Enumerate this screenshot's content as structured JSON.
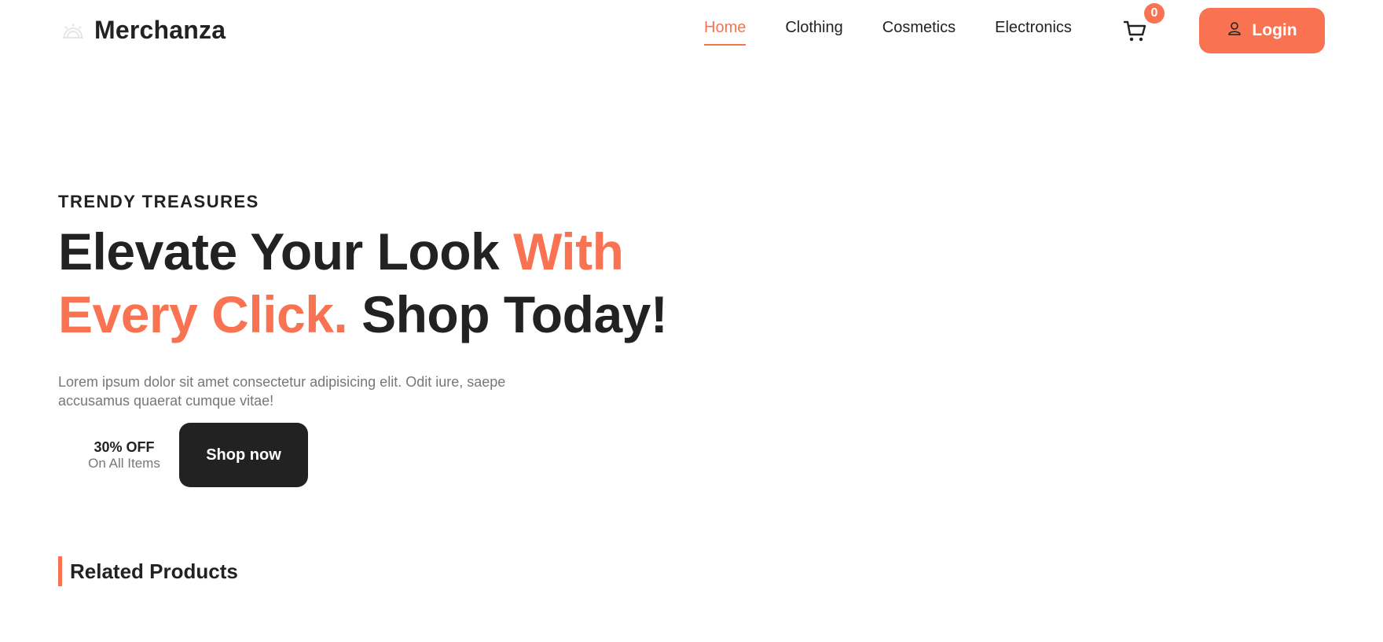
{
  "brand": {
    "name": "Merchanza",
    "logo_icon": "sunrise-logo-icon"
  },
  "nav": {
    "items": [
      {
        "label": "Home",
        "active": true
      },
      {
        "label": "Clothing",
        "active": false
      },
      {
        "label": "Cosmetics",
        "active": false
      },
      {
        "label": "Electronics",
        "active": false
      }
    ]
  },
  "cart": {
    "icon": "cart-icon",
    "count": "0"
  },
  "login": {
    "icon": "user-icon",
    "label": "Login"
  },
  "hero": {
    "eyebrow": "TRENDY TREASURES",
    "headline_part1": "Elevate Your Look ",
    "headline_accent1": "With",
    "headline_accent2": "Every Click.",
    "headline_part2": " Shop Today!",
    "description": "Lorem ipsum dolor sit amet consectetur adipisicing elit. Odit iure, saepe accusamus quaerat cumque vitae!",
    "offer_title": "30% OFF",
    "offer_subtitle": "On All Items",
    "cta_label": "Shop now"
  },
  "related": {
    "title": "Related Products"
  },
  "colors": {
    "accent": "#F97352",
    "text": "#222222",
    "muted": "#777777",
    "dark_button": "#222222"
  }
}
